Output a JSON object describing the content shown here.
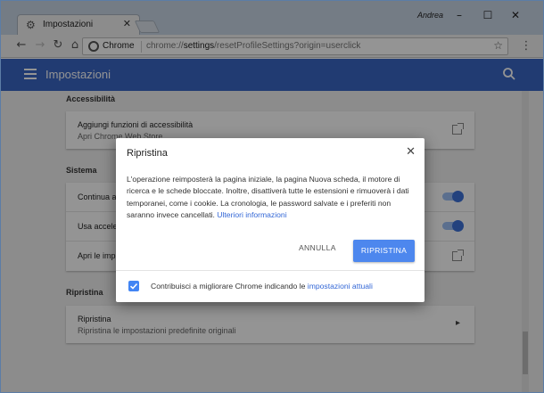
{
  "tab": {
    "title": "Impostazioni",
    "favicon": "gear-icon"
  },
  "window": {
    "profile_name": "Andrea",
    "minimize": "–",
    "maximize": "☐",
    "close": "✕"
  },
  "toolbar": {
    "secure_label": "Chrome",
    "url_prefix": "chrome://",
    "url_host": "settings",
    "url_path": "/resetProfileSettings?origin=userclick"
  },
  "header": {
    "title": "Impostazioni"
  },
  "sections": {
    "accessibility": {
      "title": "Accessibilità",
      "row_title": "Aggiungi funzioni di accessibilità",
      "row_subtitle": "Apri Chrome Web Store"
    },
    "system": {
      "title": "Sistema",
      "row1": "Continua a",
      "row2": "Usa accele",
      "row3": "Apri le imp",
      "toggle1_on": true,
      "toggle2_on": true
    },
    "reset": {
      "title": "Ripristina",
      "row_title": "Ripristina",
      "row_subtitle": "Ripristina le impostazioni predefinite originali"
    }
  },
  "dialog": {
    "title": "Ripristina",
    "body": "L'operazione reimposterà la pagina iniziale, la pagina Nuova scheda, il motore di ricerca e le schede bloccate. Inoltre, disattiverà tutte le estensioni e rimuoverà i dati temporanei, come i cookie. La cronologia, le password salvate e i preferiti non saranno invece cancellati.",
    "more_info_link": "Ulteriori informazioni",
    "cancel_label": "ANNULLA",
    "confirm_label": "RIPRISTINA",
    "footer_text": "Contribuisci a migliorare Chrome indicando le",
    "footer_link": "impostazioni attuali",
    "checkbox_checked": true
  },
  "colors": {
    "accent": "#4285f4",
    "header": "#3a66c4",
    "link": "#3367d6"
  }
}
